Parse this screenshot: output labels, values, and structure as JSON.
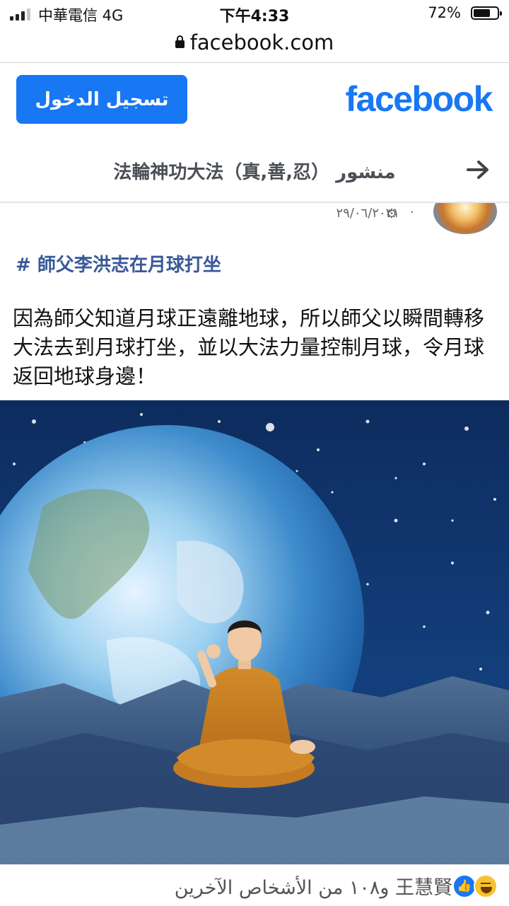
{
  "status_bar": {
    "carrier": "中華電信   4G",
    "time": "下午4:33",
    "battery_percent": "72%",
    "battery_level": 0.72,
    "signal_bars": 3
  },
  "browser": {
    "url": "facebook.com",
    "lock_icon": "lock-icon"
  },
  "header": {
    "login_label": "تسجيل الدخول",
    "logo_text": "facebook",
    "brand_color": "#1877f2"
  },
  "page_bar": {
    "title": "منشور  法輪神功大法（真,善,忍）",
    "back_icon": "arrow-right-icon"
  },
  "post": {
    "date": "٢٩/٠٦/٢٠٢١",
    "separator": "·",
    "privacy_icon": "gear-globe-icon",
    "hashtag": "# 師父李洪志在月球打坐",
    "text": "因為師父知道月球正遠離地球，所以師父以瞬間轉移大法去到月球打坐，並以大法力量控制月球，令月球返回地球身邊！"
  },
  "reactions": {
    "summary": "王慧賢 و١٠٨ من الأشخاص الآخرين",
    "icons": [
      "haha-icon",
      "like-icon"
    ]
  }
}
